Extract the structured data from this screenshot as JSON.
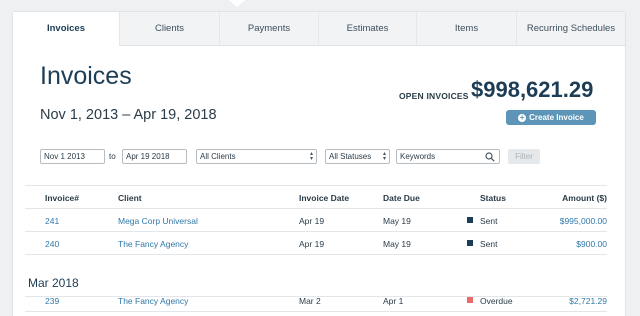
{
  "tabs": [
    {
      "label": "Invoices",
      "active": true
    },
    {
      "label": "Clients",
      "active": false
    },
    {
      "label": "Payments",
      "active": false
    },
    {
      "label": "Estimates",
      "active": false
    },
    {
      "label": "Items",
      "active": false
    },
    {
      "label": "Recurring Schedules",
      "active": false
    }
  ],
  "header": {
    "title": "Invoices",
    "date_range": "Nov 1, 2013 – Apr 19, 2018",
    "open_invoices_label": "OPEN INVOICES",
    "open_invoices_amount": "$998,621.29",
    "create_button": "Create Invoice"
  },
  "filters": {
    "from_date": "Nov 1 2013",
    "to_label": "to",
    "to_date": "Apr 19 2018",
    "client_select": "All Clients",
    "status_select": "All Statuses",
    "keywords_placeholder": "Keywords",
    "filter_button": "Filter"
  },
  "table": {
    "columns": [
      "Invoice#",
      "Client",
      "Invoice Date",
      "Date Due",
      "Status",
      "Amount ($)"
    ],
    "rows": [
      {
        "invoice": "241",
        "client": "Mega Corp Universal",
        "invoice_date": "Apr 19",
        "date_due": "May 19",
        "status": "Sent",
        "status_color": "#1c3d55",
        "amount": "$995,000.00"
      },
      {
        "invoice": "240",
        "client": "The Fancy Agency",
        "invoice_date": "Apr 19",
        "date_due": "May 19",
        "status": "Sent",
        "status_color": "#1c3d55",
        "amount": "$900.00"
      }
    ],
    "group_label": "Mar 2018",
    "group_rows": [
      {
        "invoice": "239",
        "client": "The Fancy Agency",
        "invoice_date": "Mar 2",
        "date_due": "Apr 1",
        "status": "Overdue",
        "status_color": "#e96a6a",
        "amount": "$2,721.29"
      }
    ]
  },
  "colors": {
    "accent": "#5c95b8",
    "link": "#2f78a8",
    "title": "#1c3d55",
    "overdue": "#e96a6a"
  }
}
